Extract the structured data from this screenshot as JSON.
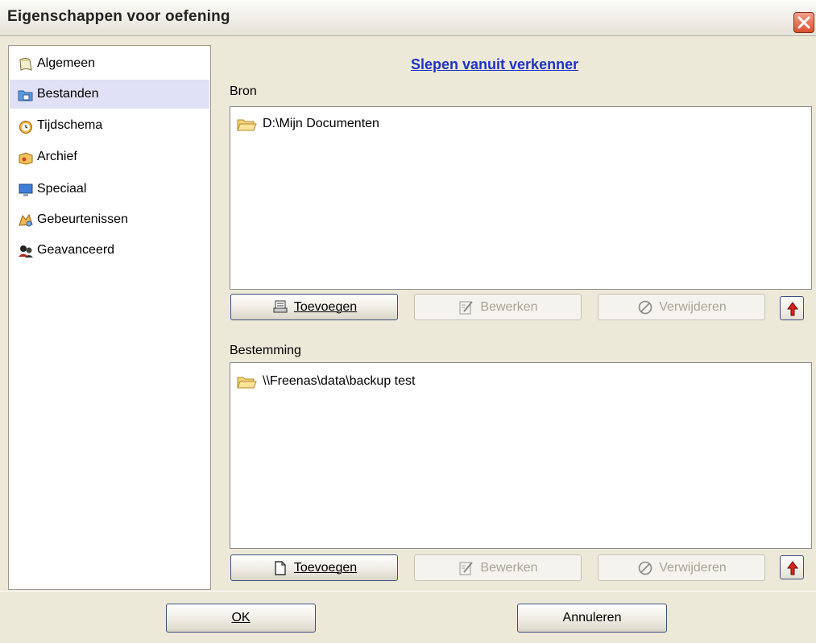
{
  "window": {
    "title": "Eigenschappen voor oefening"
  },
  "sidebar": {
    "items": [
      {
        "label": "Algemeen",
        "icon": "notepad-icon",
        "selected": false
      },
      {
        "label": "Bestanden",
        "icon": "files-folder-icon",
        "selected": true
      },
      {
        "label": "Tijdschema",
        "icon": "alarm-clock-icon",
        "selected": false
      },
      {
        "label": "Archief",
        "icon": "archive-box-icon",
        "selected": false
      },
      {
        "label": "Speciaal",
        "icon": "monitor-icon",
        "selected": false
      },
      {
        "label": "Gebeurtenissen",
        "icon": "events-icon",
        "selected": false
      },
      {
        "label": "Geavanceerd",
        "icon": "users-advanced-icon",
        "selected": false
      }
    ]
  },
  "main": {
    "drag_link": "Slepen vanuit verkenner",
    "source": {
      "label": "Bron",
      "items": [
        "D:\\Mijn Documenten"
      ],
      "add_label": "Toevoegen",
      "edit_label": "Bewerken",
      "remove_label": "Verwijderen"
    },
    "destination": {
      "label": "Bestemming",
      "items": [
        "\\\\Freenas\\data\\backup test"
      ],
      "add_label": "Toevoegen",
      "edit_label": "Bewerken",
      "remove_label": "Verwijderen"
    }
  },
  "footer": {
    "ok_label": "OK",
    "cancel_label": "Annuleren"
  },
  "colors": {
    "selected_bg": "#e0e0f6",
    "link": "#1f31c7",
    "arrow_red": "#d8231b"
  }
}
